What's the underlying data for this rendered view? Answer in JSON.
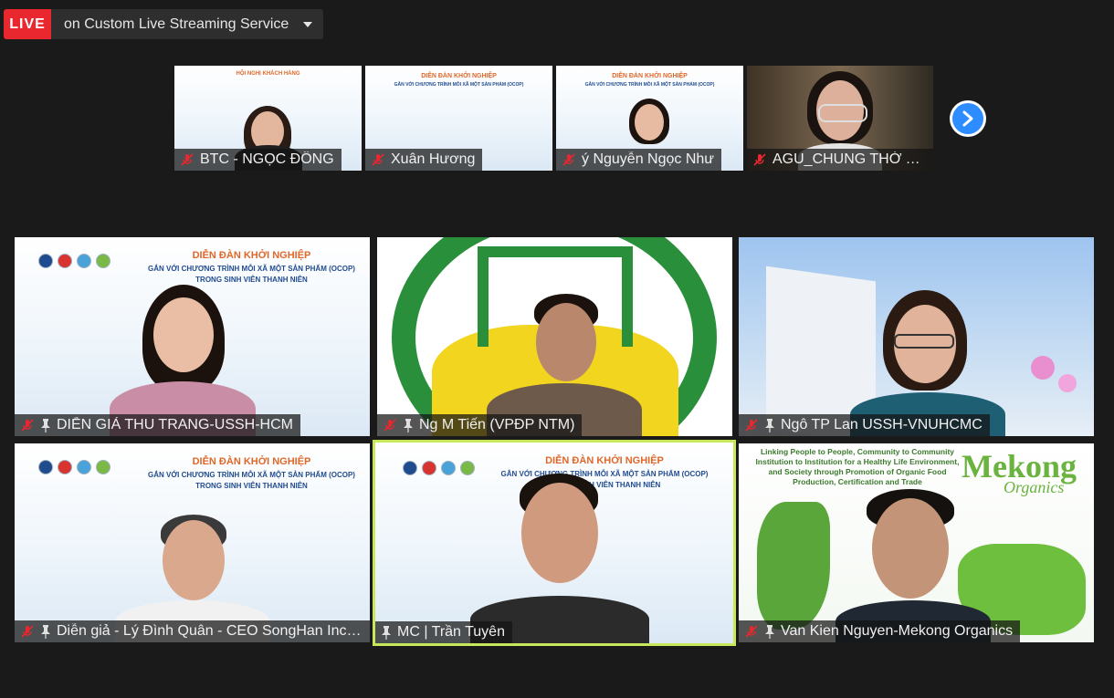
{
  "live": {
    "badge": "LIVE",
    "service": "on Custom Live Streaming Service"
  },
  "thumbnails": [
    {
      "name": "BTC - NGỌC ĐÔNG"
    },
    {
      "name": "Xuân Hương"
    },
    {
      "name": "ý Nguyễn Ngọc Như"
    },
    {
      "name": "AGU_CHUNG THỜ TH..."
    }
  ],
  "slide": {
    "title": "DIỄN ĐÀN KHỞI NGHIỆP",
    "subtitle_1": "GẮN VỚI CHƯƠNG TRÌNH MỖI XÃ MỘT SẢN PHẨM (OCOP)",
    "subtitle_2": "TRONG SINH VIÊN THANH NIÊN"
  },
  "tiles": [
    {
      "name": "DIỄN GIẢ THU TRANG-USSH-HCM"
    },
    {
      "name": "Ng M Tiến (VPĐP NTM)"
    },
    {
      "name": "Ngô TP Lan USSH-VNUHCMC"
    },
    {
      "name": "Diễn giả - Lý Đình Quân - CEO SongHan Incu..."
    },
    {
      "name": "MC | Trần Tuyên"
    },
    {
      "name": "Van Kien Nguyen-Mekong Organics"
    }
  ],
  "mekong": {
    "heading": "Linking People to People, Community to Community Institution to Institution for a Healthy Life Environment, and Society through Promotion of Organic Food Production, Certification and Trade",
    "brand": "Mekong",
    "brand_sub": "Organics"
  },
  "colors": {
    "live": "#e8272e",
    "active_speaker": "#c7e85b",
    "next_button": "#2d8cff",
    "muted": "#e8272e"
  }
}
